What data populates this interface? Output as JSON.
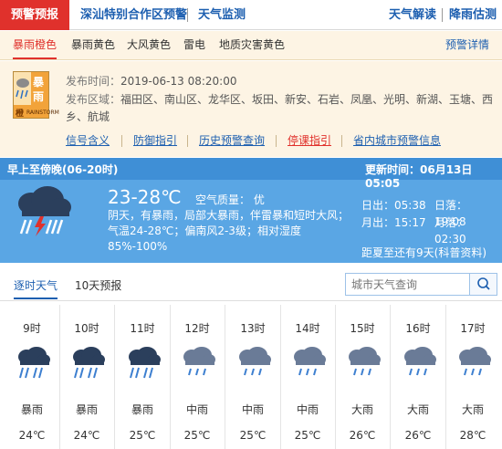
{
  "topnav": {
    "active": "预警预报",
    "items": [
      "深汕特别合作区预警",
      "天气监测"
    ],
    "right_items": [
      "天气解读",
      "降雨估测"
    ]
  },
  "warning_tabs": {
    "items": [
      "暴雨橙色",
      "暴雨黄色",
      "大风黄色",
      "雷电",
      "地质灾害黄色"
    ],
    "active_index": 0,
    "detail_link": "预警详情"
  },
  "warning": {
    "icon": {
      "name": "rainstorm-orange-warning-icon",
      "word1": "暴",
      "word2": "雨",
      "word3": "橙",
      "word4": "RAINSTORM",
      "color": "#f2a33a"
    },
    "publish_label": "发布时间：",
    "publish_time": "2019-06-13 08:20:00",
    "area_label": "发布区域：",
    "area_line1": "福田区、南山区、龙华区、坂田、新安、石岩、凤凰、光明、新湖、玉塘、西",
    "area_line2": "乡、航城",
    "links": [
      "信号含义",
      "防御指引",
      "历史预警查询",
      "停课指引",
      "省内城市预警信息"
    ]
  },
  "forecast": {
    "period_label": "早上至傍晚(06-20时)",
    "update_label": "更新时间：06月13日 05:05",
    "temp_range": "23-28℃",
    "air_quality": "空气质量：  优",
    "description": "阴天，有暴雨，局部大暴雨，伴雷暴和短时大风；气温24-28℃；偏南风2-3级；相对湿度85%-100%",
    "sunrise": "日出：05:38",
    "sunset": "日落：19:08",
    "moonrise": "月出：15:17",
    "moonset": "月落：02:30",
    "solar_term_note": "距夏至还有9天(科普资料)"
  },
  "forecast_tabs": {
    "items": [
      "逐时天气",
      "10天预报"
    ],
    "active_index": 0
  },
  "search": {
    "placeholder": "城市天气查询",
    "icon": "search-icon"
  },
  "hourly": [
    {
      "hour": "9时",
      "condition": "暴雨",
      "temp": "24℃",
      "icon": "heavy-rain-icon"
    },
    {
      "hour": "10时",
      "condition": "暴雨",
      "temp": "24℃",
      "icon": "heavy-rain-icon"
    },
    {
      "hour": "11时",
      "condition": "暴雨",
      "temp": "25℃",
      "icon": "heavy-rain-icon"
    },
    {
      "hour": "12时",
      "condition": "中雨",
      "temp": "25℃",
      "icon": "moderate-rain-icon"
    },
    {
      "hour": "13时",
      "condition": "中雨",
      "temp": "25℃",
      "icon": "moderate-rain-icon"
    },
    {
      "hour": "14时",
      "condition": "中雨",
      "temp": "25℃",
      "icon": "moderate-rain-icon"
    },
    {
      "hour": "15时",
      "condition": "大雨",
      "temp": "26℃",
      "icon": "heavy-rain-icon"
    },
    {
      "hour": "16时",
      "condition": "大雨",
      "temp": "26℃",
      "icon": "heavy-rain-icon"
    },
    {
      "hour": "17时",
      "condition": "大雨",
      "temp": "28℃",
      "icon": "heavy-rain-icon"
    }
  ],
  "colors": {
    "accent_red": "#e0312c",
    "link_blue": "#1d5fb0",
    "panel_blue": "#5aa6e4",
    "warning_bg": "#fdf4e4"
  }
}
